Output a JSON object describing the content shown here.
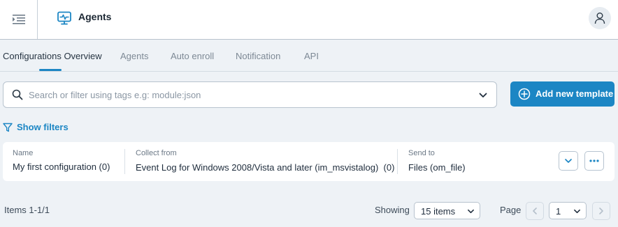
{
  "header": {
    "title": "Agents",
    "menu_icon": "menu-collapse-icon",
    "app_icon": "monitor-pulse-icon",
    "user_icon": "user-icon",
    "accent_color": "#1c86c4"
  },
  "tabs": [
    {
      "label": "Configurations Overview",
      "active": true
    },
    {
      "label": "Agents",
      "active": false
    },
    {
      "label": "Auto enroll",
      "active": false
    },
    {
      "label": "Notification",
      "active": false
    },
    {
      "label": "API",
      "active": false
    }
  ],
  "search": {
    "placeholder": "Search or filter using tags e.g: module:json",
    "value": ""
  },
  "add_button": {
    "label": "Add new template"
  },
  "filters": {
    "label": "Show filters"
  },
  "table": {
    "columns": [
      "Name",
      "Collect from",
      "Send to"
    ],
    "rows": [
      {
        "name": "My first configuration (0)",
        "collect_from": "Event Log for Windows 2008/Vista and later (im_msvistalog)",
        "collect_count": "(0)",
        "send_to": "Files (om_file)"
      }
    ]
  },
  "footer": {
    "items_text": "Items 1-1/1",
    "showing_label": "Showing",
    "page_size": "15 items",
    "page_label": "Page",
    "page_value": "1"
  }
}
